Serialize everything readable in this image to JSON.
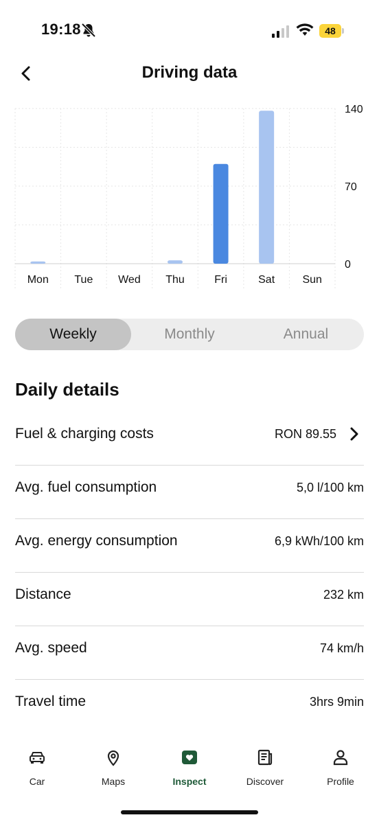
{
  "status_bar": {
    "time": "19:18",
    "battery": "48"
  },
  "header": {
    "title": "Driving data"
  },
  "chart_data": {
    "type": "bar",
    "categories": [
      "Mon",
      "Tue",
      "Wed",
      "Thu",
      "Fri",
      "Sat",
      "Sun"
    ],
    "values": [
      2,
      0,
      0,
      3,
      90,
      138,
      0
    ],
    "highlight_index": 4,
    "ylim": [
      0,
      140
    ],
    "yticks": [
      0,
      70,
      140
    ],
    "grid": true,
    "colors": {
      "bar": "#a8c4f0",
      "highlight": "#4a88e0",
      "grid": "#e6e6e6",
      "axis": "#cfcfcf"
    }
  },
  "period": {
    "options": [
      "Weekly",
      "Monthly",
      "Annual"
    ],
    "selected": "Weekly"
  },
  "daily_details": {
    "title": "Daily details",
    "rows": [
      {
        "label": "Fuel & charging costs",
        "value": "RON 89.55"
      },
      {
        "label": "Avg. fuel consumption",
        "value": "5,0 l/100 km"
      },
      {
        "label": "Avg. energy consumption",
        "value": "6,9 kWh/100 km"
      },
      {
        "label": "Distance",
        "value": "232 km"
      },
      {
        "label": "Avg. speed",
        "value": "74 km/h"
      },
      {
        "label": "Travel time",
        "value": "3hrs 9min"
      }
    ]
  },
  "nav": {
    "tabs": [
      {
        "label": "Car",
        "icon": "car-icon"
      },
      {
        "label": "Maps",
        "icon": "map-pin-icon"
      },
      {
        "label": "Inspect",
        "icon": "inspect-icon"
      },
      {
        "label": "Discover",
        "icon": "newspaper-icon"
      },
      {
        "label": "Profile",
        "icon": "person-icon"
      }
    ],
    "active": "Inspect",
    "active_color": "#1f5a38"
  }
}
